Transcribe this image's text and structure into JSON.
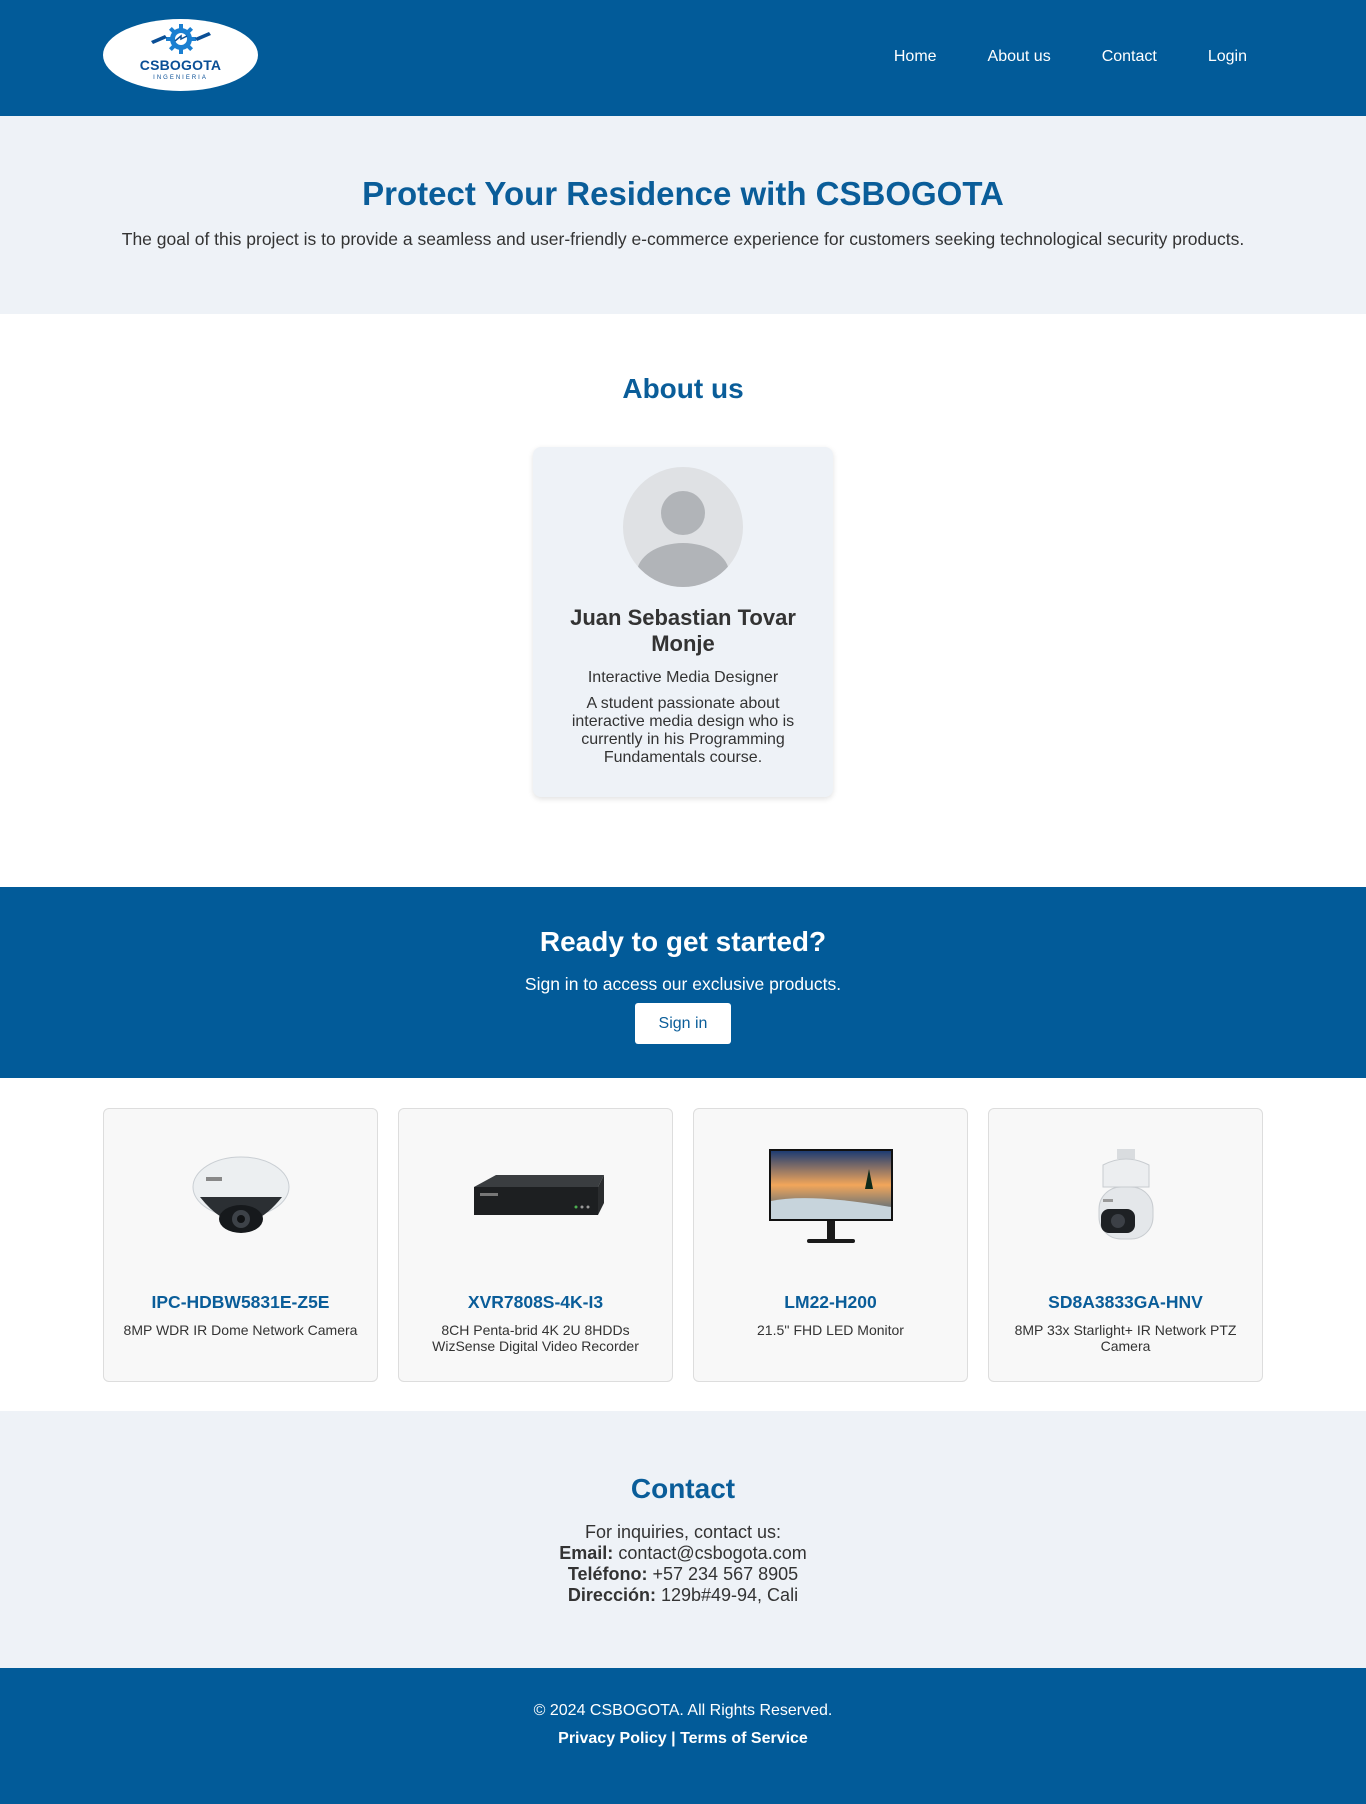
{
  "header": {
    "logo_text": "CSBOGOTA",
    "logo_sub": "INGENIERIA",
    "nav": [
      {
        "label": "Home"
      },
      {
        "label": "About us"
      },
      {
        "label": "Contact"
      },
      {
        "label": "Login"
      }
    ]
  },
  "hero": {
    "title": "Protect Your Residence with CSBOGOTA",
    "text": "The goal of this project is to provide a seamless and user-friendly e-commerce experience for customers seeking technological security products."
  },
  "about": {
    "title": "About us",
    "profile": {
      "name": "Juan Sebastian Tovar Monje",
      "role": "Interactive Media Designer",
      "bio": "A student passionate about interactive media design who is currently in his Programming Fundamentals course."
    }
  },
  "cta": {
    "title": "Ready to get started?",
    "text": "Sign in to access our exclusive products.",
    "button": "Sign in"
  },
  "products": [
    {
      "name": "IPC-HDBW5831E-Z5E",
      "desc": "8MP WDR IR Dome Network Camera",
      "icon": "dome-camera-image"
    },
    {
      "name": "XVR7808S-4K-I3",
      "desc": "8CH Penta-brid 4K 2U 8HDDs WizSense Digital Video Recorder",
      "icon": "video-recorder-image"
    },
    {
      "name": "LM22-H200",
      "desc": "21.5'' FHD LED Monitor",
      "icon": "monitor-image"
    },
    {
      "name": "SD8A3833GA-HNV",
      "desc": "8MP 33x Starlight+ IR Network PTZ Camera",
      "icon": "ptz-camera-image"
    }
  ],
  "contact": {
    "title": "Contact",
    "intro": "For inquiries, contact us:",
    "email_label": "Email:",
    "email": "contact@csbogota.com",
    "phone_label": "Teléfono:",
    "phone": "+57 234 567 8905",
    "address_label": "Dirección:",
    "address": "129b#49-94, Cali"
  },
  "footer": {
    "copyright": "© 2024 CSBOGOTA. All Rights Reserved.",
    "privacy": "Privacy Policy",
    "separator": "|",
    "terms": "Terms of Service"
  },
  "colors": {
    "primary": "#025b99",
    "heading": "#0a5d99",
    "light_bg": "#eef2f7"
  }
}
